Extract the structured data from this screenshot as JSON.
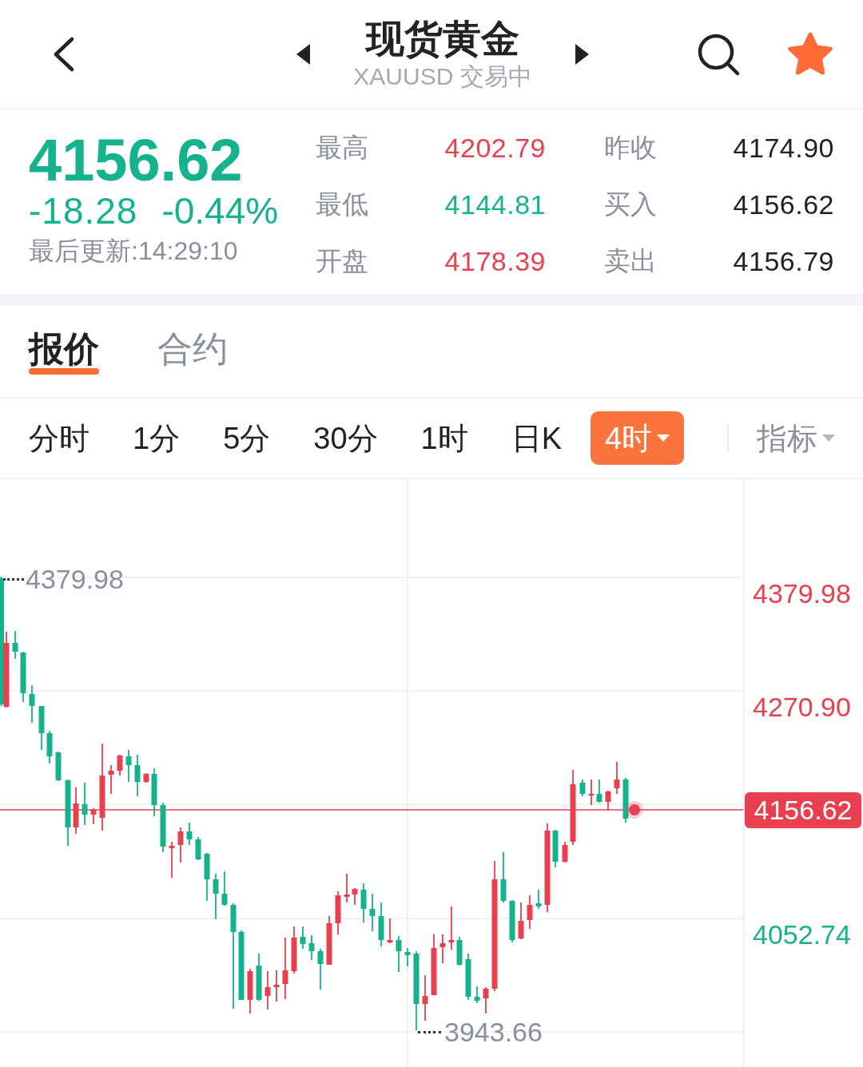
{
  "header": {
    "title": "现货黄金",
    "subtitle": "XAUUSD 交易中",
    "favorite": true
  },
  "quote": {
    "rising": false,
    "price": "4156.62",
    "change": "-18.28",
    "change_percent": "-0.44%",
    "last_update": "最后更新:14:29:10",
    "stats": [
      {
        "label": "最高",
        "value": "4202.79",
        "color": "#e8404f"
      },
      {
        "label": "昨收",
        "value": "4174.90",
        "color": "#222222"
      },
      {
        "label": "最低",
        "value": "4144.81",
        "color": "#14b38d"
      },
      {
        "label": "买入",
        "value": "4156.62",
        "color": "#222222"
      },
      {
        "label": "开盘",
        "value": "4178.39",
        "color": "#e8404f"
      },
      {
        "label": "卖出",
        "value": "4156.79",
        "color": "#222222"
      }
    ]
  },
  "tabs": [
    {
      "label": "报价",
      "selected": true
    },
    {
      "label": "合约",
      "selected": false
    }
  ],
  "intervals": [
    {
      "label": "分时",
      "selected": false,
      "dropdown": false
    },
    {
      "label": "1分",
      "selected": false,
      "dropdown": false
    },
    {
      "label": "5分",
      "selected": false,
      "dropdown": false
    },
    {
      "label": "30分",
      "selected": false,
      "dropdown": false
    },
    {
      "label": "1时",
      "selected": false,
      "dropdown": false
    },
    {
      "label": "日K",
      "selected": false,
      "dropdown": false
    },
    {
      "label": "4时",
      "selected": true,
      "dropdown": true
    }
  ],
  "indicator_menu": {
    "label": "指标"
  },
  "chart": {
    "high_label": "4379.98",
    "low_label": "3943.66",
    "axis_labels": [
      {
        "text": "4379.98",
        "color": "#e8404f"
      },
      {
        "text": "4270.90",
        "color": "#e8404f"
      },
      {
        "text": "4052.74",
        "color": "#14b38d"
      }
    ],
    "current_price": "4156.62"
  }
}
